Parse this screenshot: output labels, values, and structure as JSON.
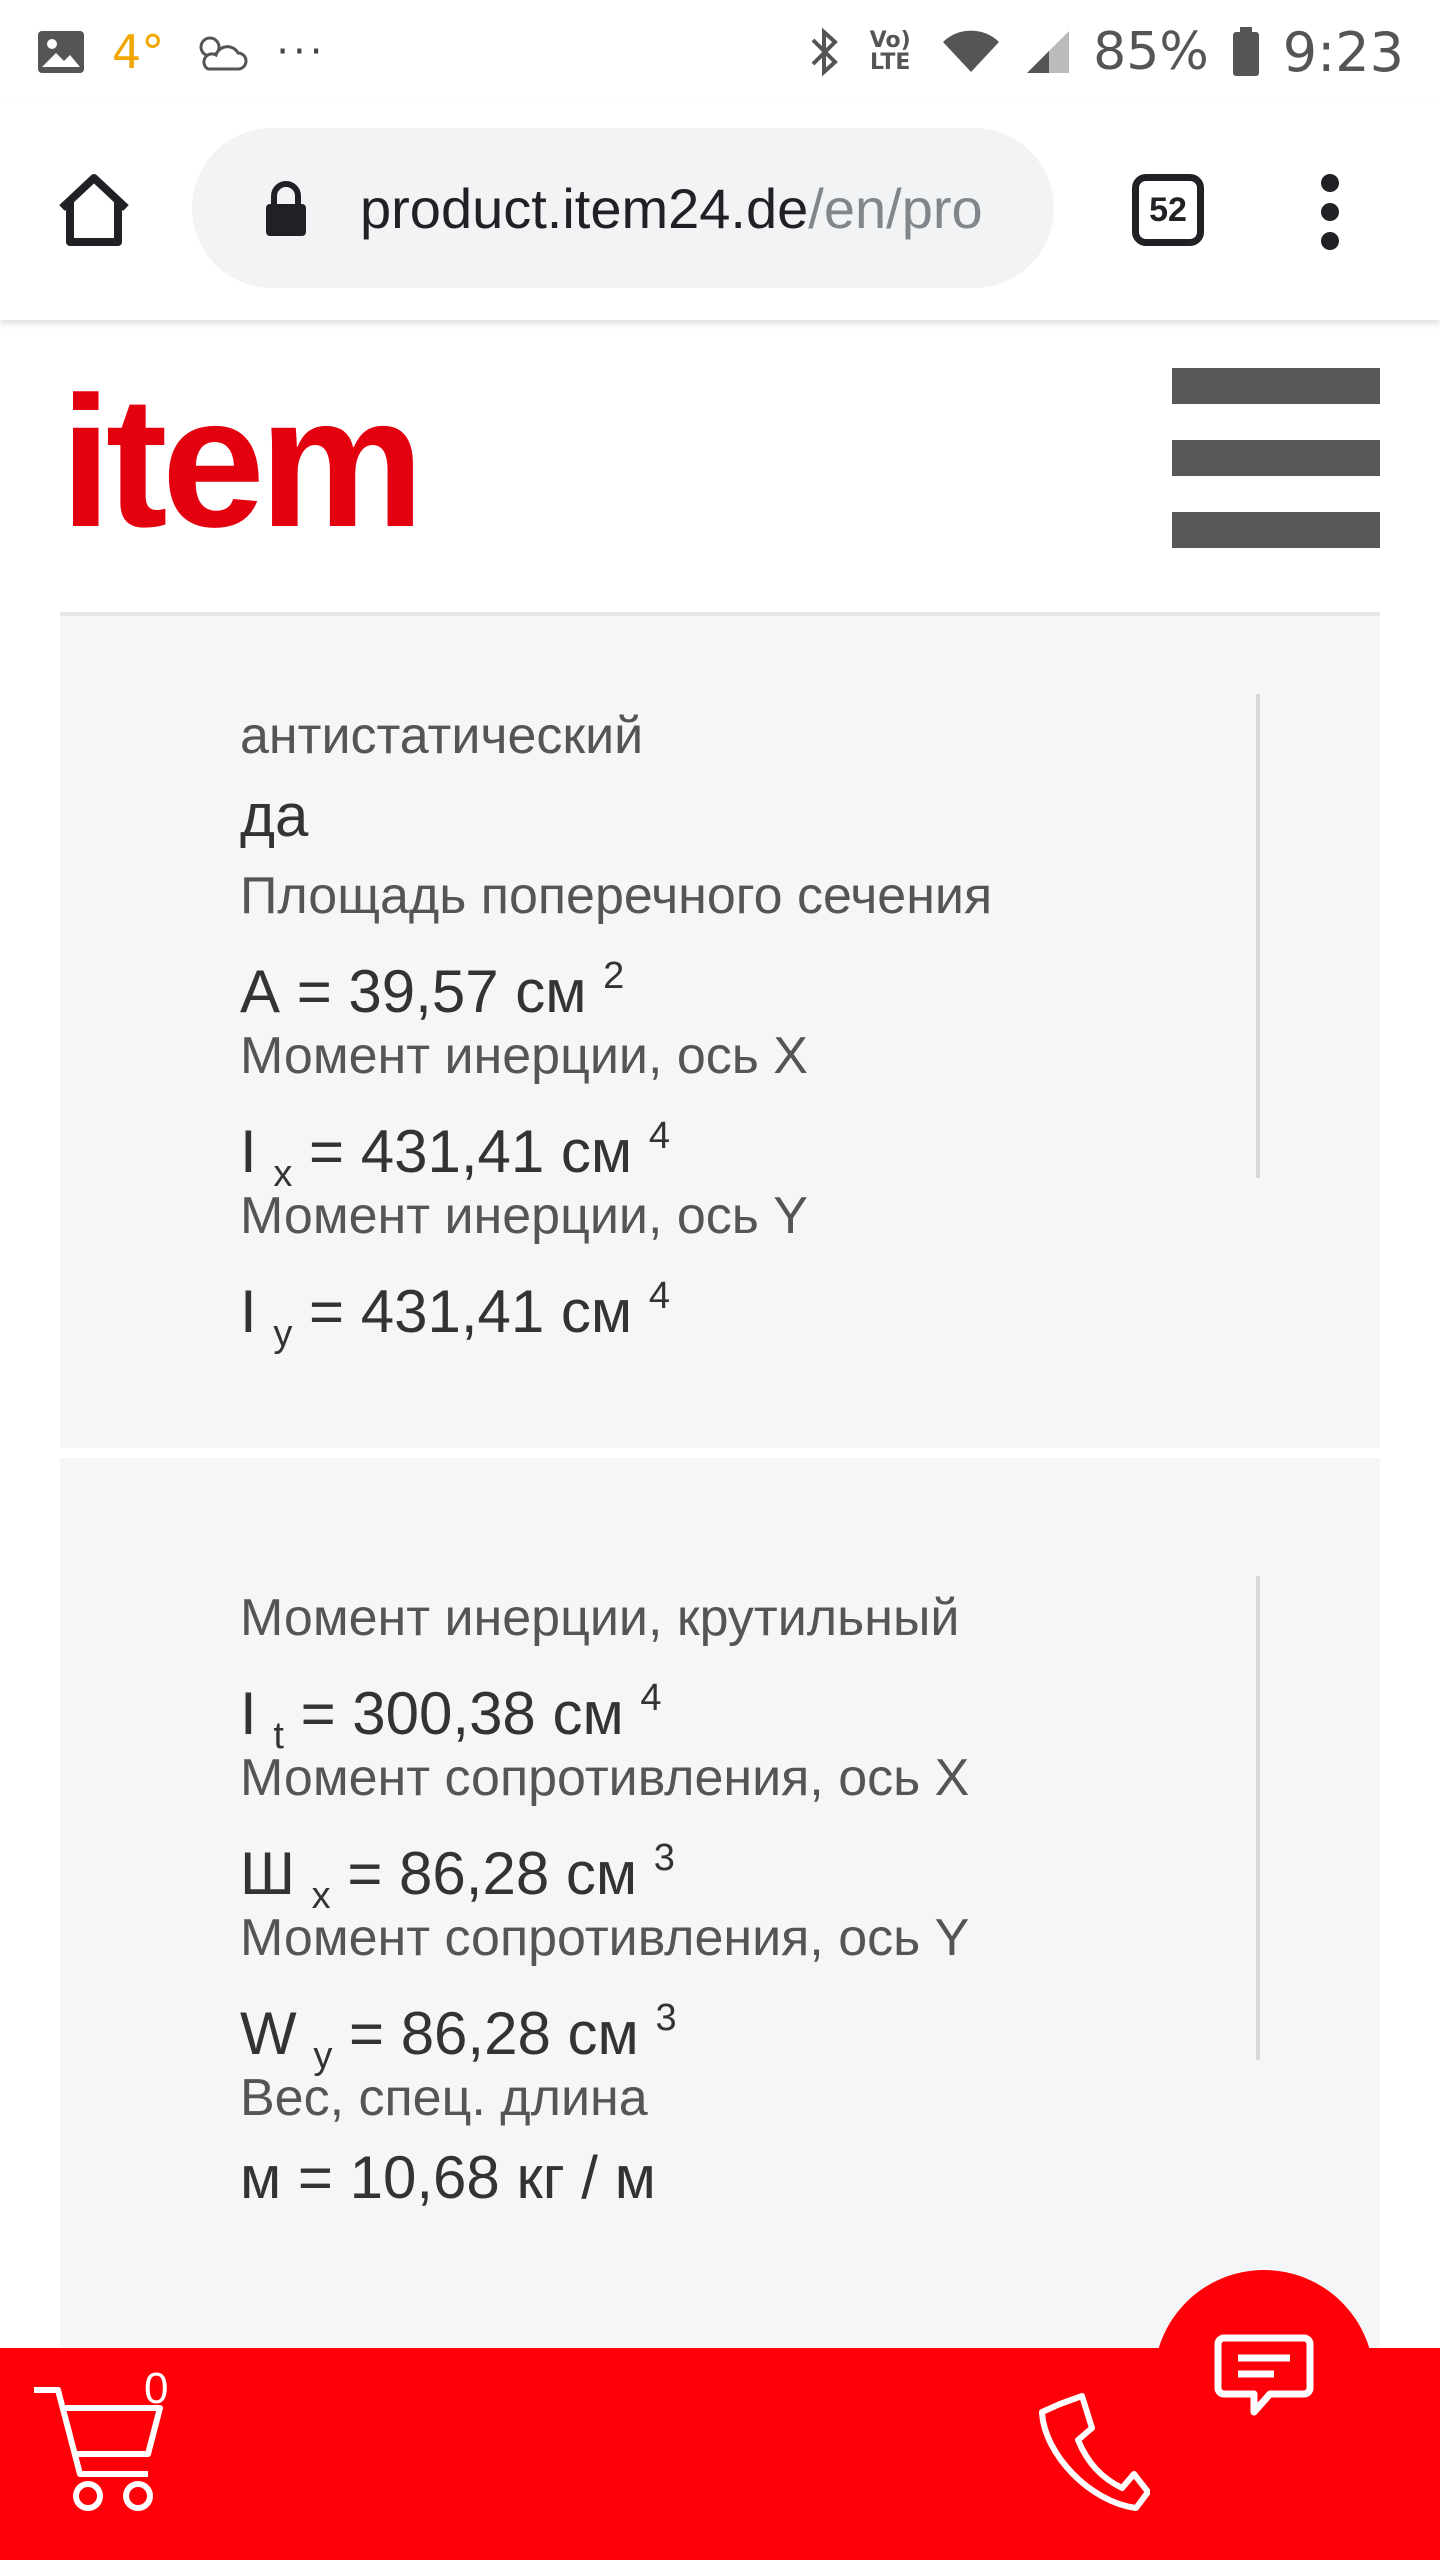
{
  "status_bar": {
    "temperature": "4°",
    "more": "···",
    "lte": "Vo) LTE",
    "battery": "85%",
    "time": "9:23"
  },
  "browser": {
    "url_host": "product.item24.de",
    "url_path": "/en/pro",
    "tab_count": "52"
  },
  "site": {
    "logo": "item"
  },
  "card1": [
    {
      "label": "антистатический",
      "value": "да"
    },
    {
      "label": "Площадь поперечного сечения",
      "symbol": "A",
      "sub": "",
      "rest": " = 39,57 см ",
      "sup": "2"
    },
    {
      "label": "Момент инерции, ось X",
      "symbol": "I ",
      "sub": "x",
      "rest": " = 431,41 см ",
      "sup": "4"
    },
    {
      "label": "Момент инерции, ось Y",
      "symbol": "I ",
      "sub": "y",
      "rest": " = 431,41 см ",
      "sup": "4"
    }
  ],
  "card2": [
    {
      "label": "Момент инерции, крутильный",
      "symbol": "I ",
      "sub": "t",
      "rest": " = 300,38 см ",
      "sup": "4"
    },
    {
      "label": "Момент сопротивления, ось X",
      "symbol": "Ш ",
      "sub": "x",
      "rest": " = 86,28 см ",
      "sup": "3"
    },
    {
      "label": "Момент сопротивления, ось Y",
      "symbol": "W ",
      "sub": "y",
      "rest": " = 86,28 см ",
      "sup": "3"
    },
    {
      "label": "Вес, спец. длина",
      "value": "м = 10,68 кг / м"
    }
  ],
  "bottom": {
    "cart_count": "0"
  },
  "colors": {
    "brand_red": "#e3000f",
    "bar_red": "#ff0008",
    "card_bg": "#f5f6f7"
  }
}
